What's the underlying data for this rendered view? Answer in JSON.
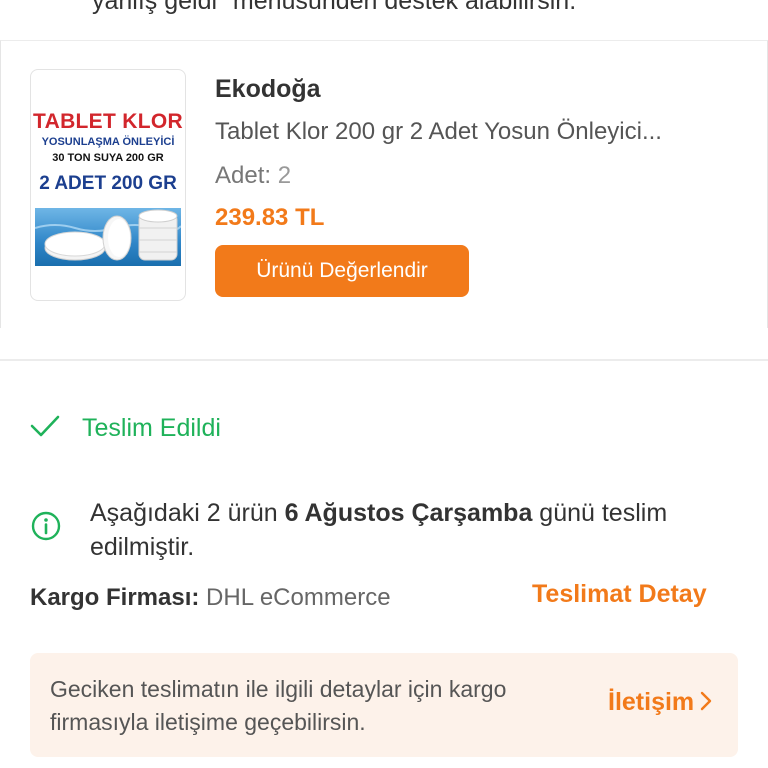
{
  "header": {
    "support_note": "yanlış geldi\" menüsünden destek alabilirsin."
  },
  "product": {
    "image_label": {
      "line1": "TABLET KLOR",
      "line2": "YOSUNLAŞMA ÖNLEYİCİ",
      "line3": "30 TON SUYA 200 GR",
      "line4": "2 ADET 200 GR"
    },
    "brand": "Ekodoğa",
    "name": "Tablet Klor 200 gr 2 Adet Yosun Önleyici...",
    "quantity_label": "Adet:",
    "quantity_value": "2",
    "price": "239.83 TL",
    "rate_button": "Ürünü Değerlendir"
  },
  "delivery": {
    "status": "Teslim Edildi",
    "info_prefix": "Aşağıdaki 2 ürün ",
    "info_date": "6 Ağustos Çarşamba",
    "info_suffix": " günü teslim edilmiştir.",
    "carrier_label": "Kargo Firması:",
    "carrier_value": "DHL eCommerce",
    "detail_link": "Teslimat Detay"
  },
  "notice": {
    "message": "Geciken teslimatın ile ilgili detaylar için kargo firmasıyla iletişime geçebilirsin.",
    "contact_link": "İletişim"
  },
  "colors": {
    "accent": "#f27a1a",
    "success": "#1fb25a",
    "notice_bg": "#fdf2ea"
  },
  "icons": {
    "status": "check-icon",
    "info": "info-circle-icon",
    "chevron": "chevron-right-icon"
  }
}
